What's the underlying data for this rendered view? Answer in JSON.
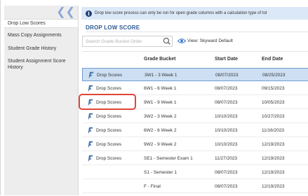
{
  "sidebar": {
    "items": [
      {
        "label": "Drop Low Scores",
        "active": true
      },
      {
        "label": "Mass Copy Assignments",
        "active": false
      },
      {
        "label": "Student Grade History",
        "active": false
      },
      {
        "label": "Student Assignment Score History",
        "active": false
      }
    ]
  },
  "banner": {
    "icon": "info-icon",
    "text": "Drop low score process can only be run for open grade columns with a calculation type of tot"
  },
  "section": {
    "title": "DROP LOW SCORE"
  },
  "search": {
    "placeholder": "Search Grade Bucket Order",
    "value": ""
  },
  "view": {
    "label": "View: Skyward Default"
  },
  "table": {
    "headers": [
      "",
      "Grade Bucket",
      "Start Date",
      "End Date"
    ],
    "rows": [
      {
        "action": "Drop Scores",
        "bucket": "3W1 - 3 Week 1",
        "start": "08/07/2023",
        "end": "08/25/2023"
      },
      {
        "action": "Drop Scores",
        "bucket": "6W1 - 6 Week 1",
        "start": "08/07/2023",
        "end": "09/15/2023"
      },
      {
        "action": "Drop Scores",
        "bucket": "9W1 - 9 Week 1",
        "start": "08/07/2023",
        "end": "10/05/2023"
      },
      {
        "action": "Drop Scores",
        "bucket": "3W2 - 3 Week 2",
        "start": "10/10/2023",
        "end": "10/27/2023"
      },
      {
        "action": "Drop Scores",
        "bucket": "6W2 - 6 Week 2",
        "start": "10/10/2023",
        "end": "11/16/2023"
      },
      {
        "action": "Drop Scores",
        "bucket": "9W2 - 9 Week 2",
        "start": "10/10/2023",
        "end": "12/19/2023"
      },
      {
        "action": "Drop Scores",
        "bucket": "SE1 - Semester Exam 1",
        "start": "11/27/2023",
        "end": "12/19/2023"
      },
      {
        "action": "",
        "bucket": "S1 - Semester 1",
        "start": "08/07/2023",
        "end": "12/19/2023"
      },
      {
        "action": "",
        "bucket": "F - Final",
        "start": "08/07/2023",
        "end": "12/19/2023"
      }
    ]
  },
  "colors": {
    "accent": "#2f5b93",
    "selected_row": "#cddff3",
    "highlight": "#e0453a"
  }
}
